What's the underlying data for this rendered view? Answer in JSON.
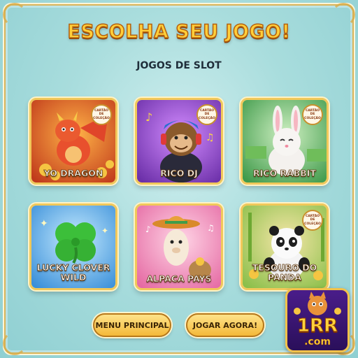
{
  "title": "ESCOLHA SEU JOGO!",
  "subtitle": "JOGOS DE SLOT",
  "badge_text": "CARTÃO DE COLEÇÃO",
  "games": [
    {
      "label": "YO DRAGON",
      "has_badge": true
    },
    {
      "label": "RICO DJ",
      "has_badge": true
    },
    {
      "label": "RICO RABBIT",
      "has_badge": true
    },
    {
      "label": "LUCKY CLOVER WILD",
      "has_badge": false
    },
    {
      "label": "ALPACA PAYS",
      "has_badge": false
    },
    {
      "label": "TESOURO DO PANDA",
      "has_badge": true
    }
  ],
  "buttons": {
    "main_menu": "MENU PRINCIPAL",
    "play_now": "JOGAR AGORA!"
  },
  "logo": {
    "brand": "1RR",
    "suffix": ".com"
  },
  "colors": {
    "title": "#ffcf3a",
    "frame": "#d9b45a",
    "button": "#f4b939"
  }
}
